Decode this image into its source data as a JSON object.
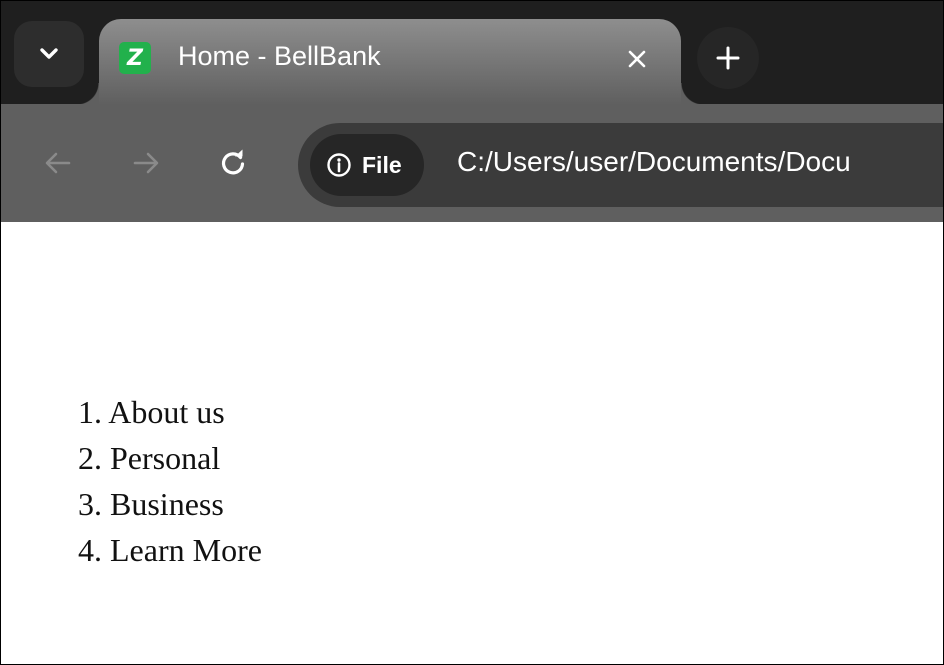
{
  "browser": {
    "tab": {
      "title": "Home - BellBank",
      "favicon_letter": "Z",
      "favicon_color": "#22b14c"
    },
    "address_bar": {
      "security_chip_label": "File",
      "url": "C:/Users/user/Documents/Docu"
    },
    "colors": {
      "tabstrip_bg": "#1f1f1f",
      "toolbar_bg": "#5f5f5f",
      "omnibox_bg": "#3b3b3b"
    }
  },
  "page": {
    "nav_items": [
      {
        "number": "1.",
        "label": "About us"
      },
      {
        "number": "2.",
        "label": "Personal"
      },
      {
        "number": "3.",
        "label": "Business"
      },
      {
        "number": "4.",
        "label": "Learn More"
      }
    ]
  }
}
